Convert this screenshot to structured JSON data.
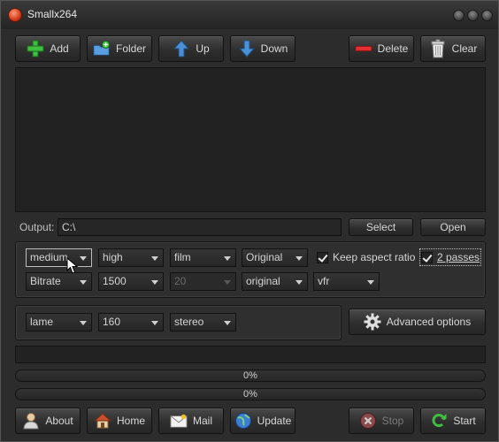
{
  "window": {
    "title": "Smallx264"
  },
  "toolbar": {
    "add": "Add",
    "folder": "Folder",
    "up": "Up",
    "down": "Down",
    "delete": "Delete",
    "clear": "Clear"
  },
  "output": {
    "label": "Output:",
    "path": "C:\\",
    "select": "Select",
    "open": "Open"
  },
  "video": {
    "preset": "medium",
    "profile": "high",
    "tune": "film",
    "size": "Original",
    "keep_aspect": "Keep aspect ratio",
    "keep_aspect_checked": true,
    "two_passes": "2 passes",
    "two_passes_checked": true,
    "ratecontrol": "Bitrate",
    "bitrate": "1500",
    "crf": "20",
    "fps": "original",
    "framerate_mode": "vfr"
  },
  "audio": {
    "codec": "lame",
    "bitrate": "160",
    "channels": "stereo",
    "advanced": "Advanced options"
  },
  "progress": [
    {
      "text": "0%",
      "value": 0
    },
    {
      "text": "0%",
      "value": 0
    }
  ],
  "bottom": {
    "about": "About",
    "home": "Home",
    "mail": "Mail",
    "update": "Update",
    "stop": "Stop",
    "start": "Start"
  }
}
